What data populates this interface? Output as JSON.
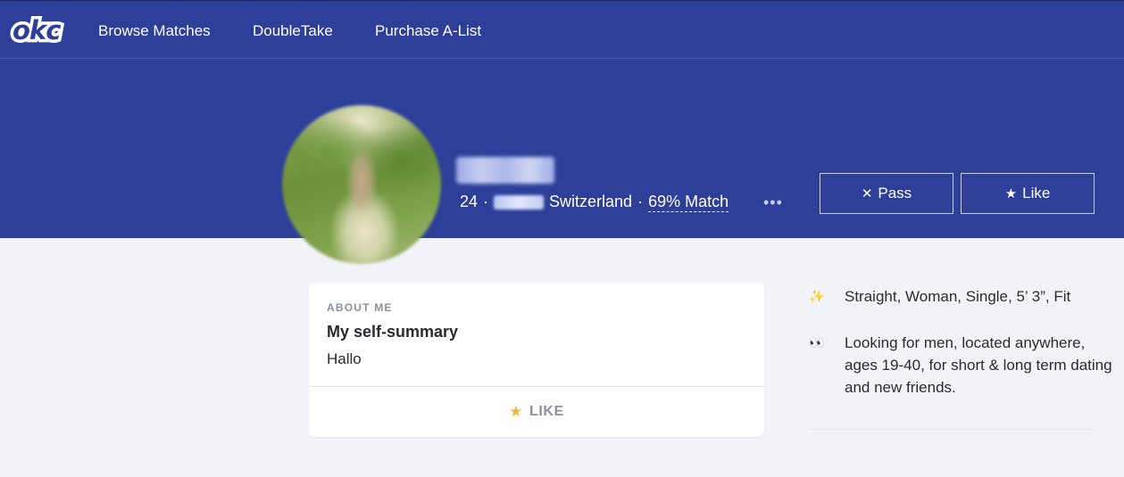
{
  "nav": {
    "logo": "okc",
    "items": [
      "Browse Matches",
      "DoubleTake",
      "Purchase A-List"
    ]
  },
  "profile": {
    "age": "24",
    "separator": "·",
    "country": "Switzerland",
    "match": "69% Match",
    "more": "•••"
  },
  "actions": {
    "pass_label": "Pass",
    "like_label": "Like"
  },
  "about": {
    "section_label": "ABOUT ME",
    "title": "My self-summary",
    "body": "Hallo",
    "like_label": "LIKE"
  },
  "details": [
    {
      "icon": "sparkles-icon",
      "glyph": "✨",
      "text": "Straight, Woman, Single, 5’ 3”, Fit"
    },
    {
      "icon": "eyes-icon",
      "glyph": "👀",
      "text": "Looking for men, located anywhere, ages 19-40, for short & long term dating and new friends."
    }
  ],
  "colors": {
    "brand_blue": "#2e3f9a",
    "background": "#f2f3f8",
    "star": "#f1b53a"
  }
}
